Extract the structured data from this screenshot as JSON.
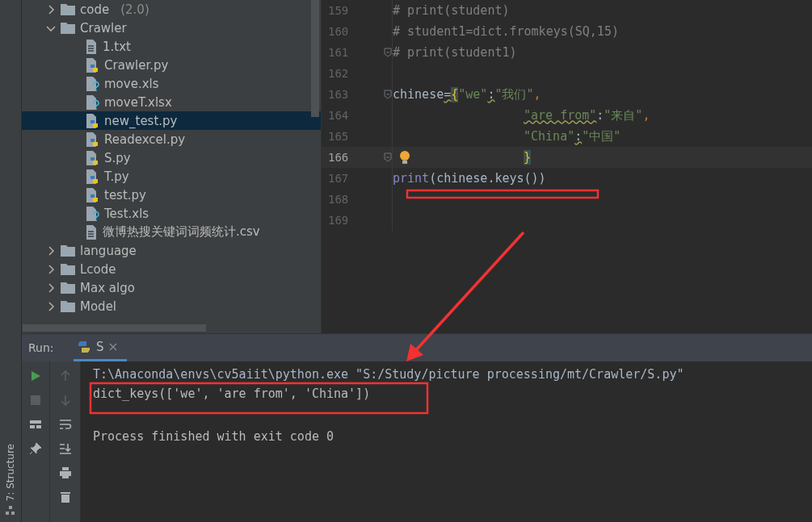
{
  "side_strip": {
    "label": "7: Structure"
  },
  "project_tree": {
    "items": [
      {
        "kind": "folder",
        "label": "code",
        "note": "(2.0)",
        "expanded": false,
        "selected": false
      },
      {
        "kind": "folder",
        "label": "Crawler",
        "expanded": true,
        "selected": false,
        "children": [
          {
            "kind": "text",
            "label": "1.txt",
            "selected": false
          },
          {
            "kind": "python",
            "label": "Crawler.py",
            "selected": false
          },
          {
            "kind": "unknown",
            "label": "move.xls",
            "selected": false
          },
          {
            "kind": "unknown",
            "label": "moveT.xlsx",
            "selected": false
          },
          {
            "kind": "python",
            "label": "new_test.py",
            "selected": true
          },
          {
            "kind": "python",
            "label": "Readexcel.py",
            "selected": false
          },
          {
            "kind": "python",
            "label": "S.py",
            "selected": false
          },
          {
            "kind": "python",
            "label": "T.py",
            "selected": false
          },
          {
            "kind": "python",
            "label": "test.py",
            "selected": false
          },
          {
            "kind": "unknown",
            "label": "Test.xls",
            "selected": false
          },
          {
            "kind": "text",
            "label": "微博热搜关键词词频统计.csv",
            "selected": false
          }
        ]
      },
      {
        "kind": "folder",
        "label": "language",
        "expanded": false,
        "selected": false
      },
      {
        "kind": "folder",
        "label": "Lcode",
        "expanded": false,
        "selected": false
      },
      {
        "kind": "folder",
        "label": "Max algo",
        "expanded": false,
        "selected": false
      },
      {
        "kind": "folder",
        "label": "Model",
        "expanded": false,
        "selected": false
      }
    ]
  },
  "editor": {
    "lines": [
      {
        "number": "159",
        "current": false,
        "tokens": [
          {
            "kind": "comment",
            "text": "# print(student)"
          }
        ]
      },
      {
        "number": "160",
        "current": false,
        "tokens": [
          {
            "kind": "comment",
            "text": "# student1=dict.fromkeys(SQ,15)"
          }
        ]
      },
      {
        "number": "161",
        "current": false,
        "fold_marker": true,
        "tokens": [
          {
            "kind": "comment",
            "text": "# print(student1)"
          }
        ]
      },
      {
        "number": "162",
        "current": false
      },
      {
        "number": "163",
        "current": false,
        "fold_marker": true,
        "tokens": [
          {
            "kind": "ident",
            "text": "chinese"
          },
          {
            "kind": "punct",
            "text": "=",
            "squiggle": true
          },
          {
            "kind": "brace",
            "text": "{"
          },
          {
            "kind": "string",
            "text": "\"we\""
          },
          {
            "kind": "punct",
            "text": ":",
            "squiggle": true
          },
          {
            "kind": "string",
            "text": "\"我们\""
          },
          {
            "kind": "comma",
            "text": ","
          }
        ]
      },
      {
        "number": "164",
        "current": false,
        "continuation": true,
        "tokens": [
          {
            "kind": "string",
            "text": "\"are from\"",
            "squiggle": true
          },
          {
            "kind": "punct",
            "text": ":"
          },
          {
            "kind": "string",
            "text": "\"来自\""
          },
          {
            "kind": "comma",
            "text": ","
          }
        ]
      },
      {
        "number": "165",
        "current": false,
        "continuation": true,
        "tokens": [
          {
            "kind": "string",
            "text": "\"China\""
          },
          {
            "kind": "punct",
            "text": ":",
            "squiggle": true
          },
          {
            "kind": "string",
            "text": "\"中国\""
          }
        ]
      },
      {
        "number": "166",
        "current": true,
        "continuation": true,
        "fold_marker": true,
        "hint_bulb": true,
        "tokens": [
          {
            "kind": "brace",
            "text": "}"
          }
        ]
      },
      {
        "number": "167",
        "current": false,
        "tokens": [
          {
            "kind": "builtin",
            "text": "print"
          },
          {
            "kind": "ident",
            "text": "(chinese.keys())"
          }
        ]
      },
      {
        "number": "168",
        "current": false
      },
      {
        "number": "169",
        "current": false
      }
    ]
  },
  "run_panel": {
    "label": "Run:",
    "tabs": [
      {
        "label": "S",
        "selected": true
      }
    ],
    "console": [
      {
        "kind": "command",
        "text": "T:\\Anaconda\\envs\\cv5aiit\\python.exe \"S:/Study/picture processing/mt/Crawler/S.py\""
      },
      {
        "kind": "output",
        "text": "dict_keys(['we', 'are from', 'China'])"
      },
      {
        "kind": "status",
        "text": "Process finished with exit code 0"
      }
    ]
  }
}
